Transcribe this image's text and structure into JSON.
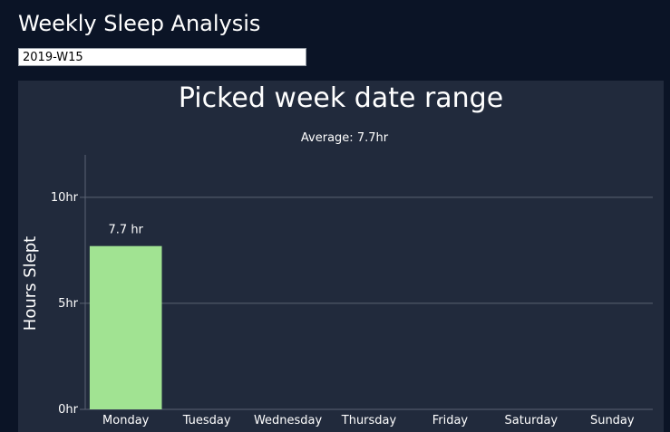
{
  "page": {
    "title": "Weekly Sleep Analysis"
  },
  "week_picker": {
    "value": "2019-W15"
  },
  "colors": {
    "background": "#0b1426",
    "panel": "#212a3c",
    "bar": "#a1e392",
    "grid": "#5b6373",
    "text": "#ffffff"
  },
  "chart_data": {
    "type": "bar",
    "title": "Picked week date range",
    "subtitle": "Average: 7.7hr",
    "ylabel": "Hours Slept",
    "xlabel": "",
    "categories": [
      "Monday",
      "Tuesday",
      "Wednesday",
      "Thursday",
      "Friday",
      "Saturday",
      "Sunday"
    ],
    "values": [
      7.7,
      0,
      0,
      0,
      0,
      0,
      0
    ],
    "data_labels": [
      "7.7 hr",
      "",
      "",
      "",
      "",
      "",
      ""
    ],
    "ylim": [
      0,
      12
    ],
    "yticks": [
      0,
      5,
      10
    ],
    "ytick_labels": [
      "0hr",
      "5hr",
      "10hr"
    ],
    "grid": true,
    "legend": "none"
  }
}
